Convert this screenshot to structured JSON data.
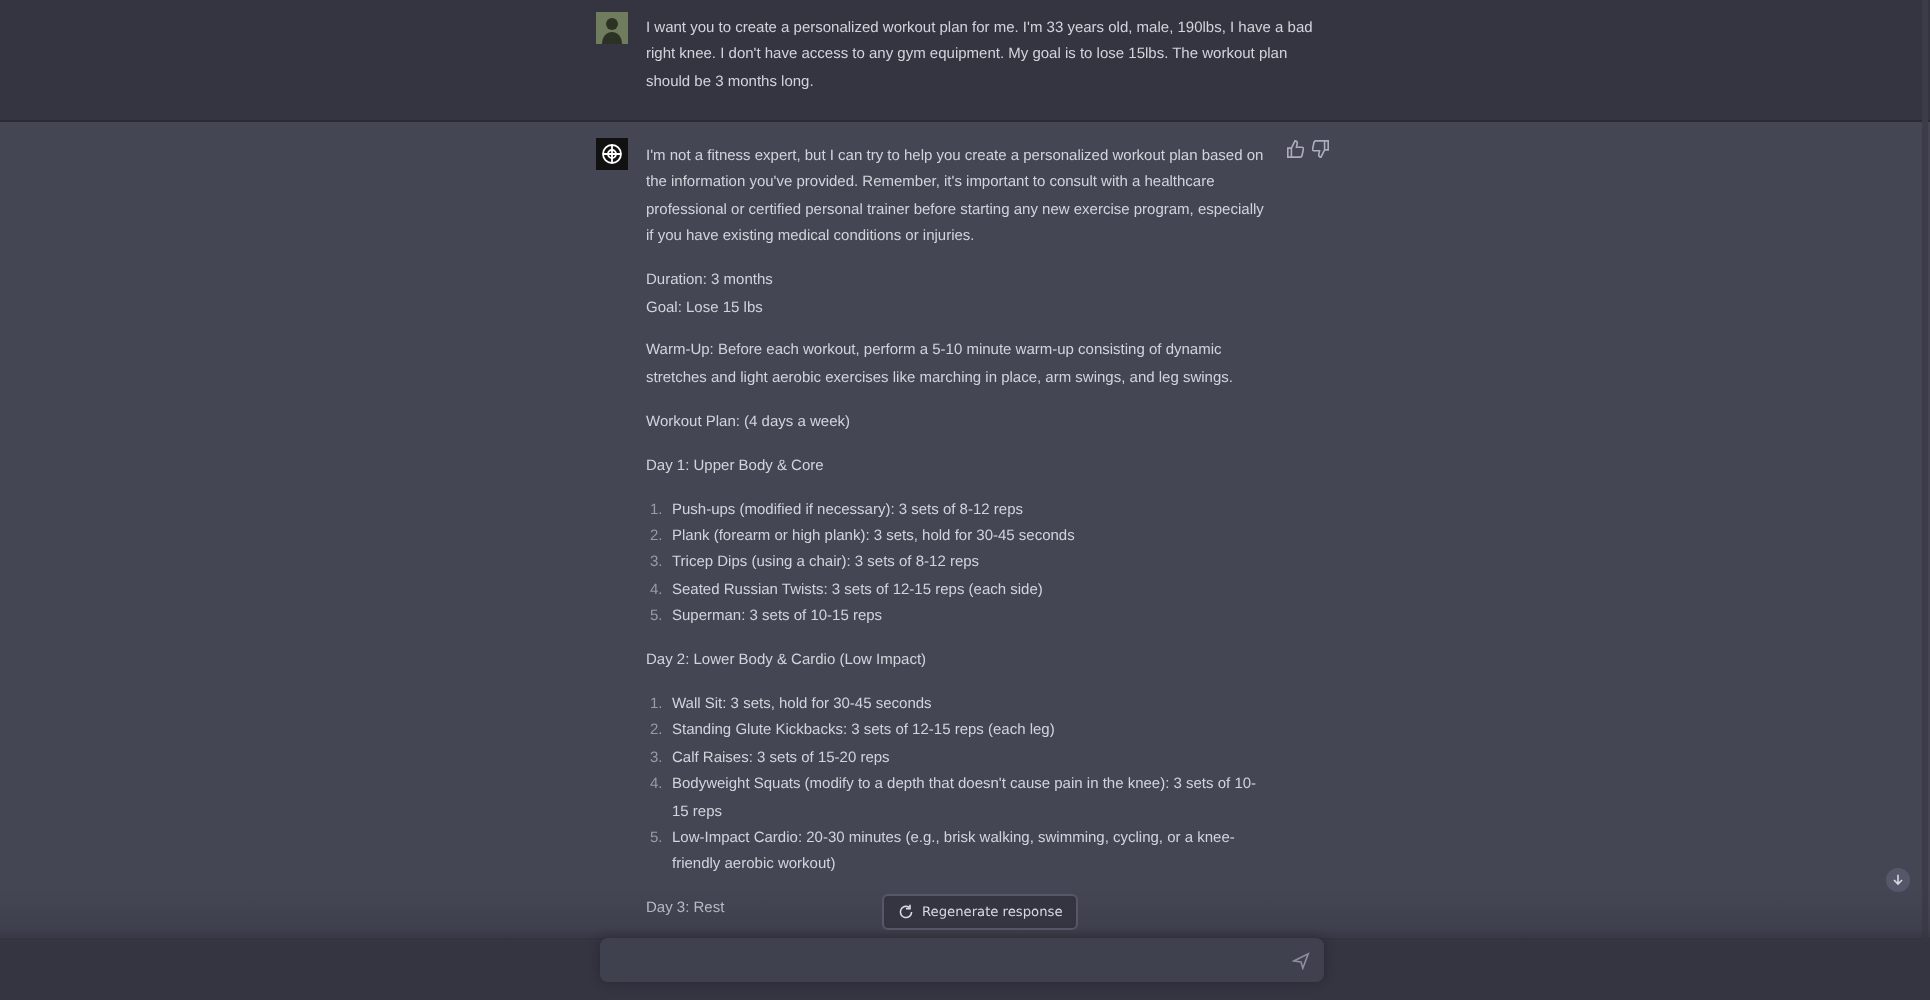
{
  "conversation": [
    {
      "kind": "user",
      "blocks": [
        {
          "kind": "paragraph",
          "text": "I want you to create a personalized workout plan for me. I'm 33 years old, male, 190lbs, I have a bad right knee. I don't have access to any gym equipment. My goal is to lose 15lbs. The workout plan should be 3 months long."
        }
      ]
    },
    {
      "kind": "assistant",
      "blocks": [
        {
          "kind": "paragraph",
          "text": "I'm not a fitness expert, but I can try to help you create a personalized workout plan based on the information you've provided. Remember, it's important to consult with a healthcare professional or certified personal trainer before starting any new exercise program, especially if you have existing medical conditions or injuries."
        },
        {
          "kind": "lines",
          "lines": [
            "Duration: 3 months",
            "Goal: Lose 15 lbs"
          ]
        },
        {
          "kind": "paragraph",
          "text": "Warm-Up: Before each workout, perform a 5-10 minute warm-up consisting of dynamic stretches and light aerobic exercises like marching in place, arm swings, and leg swings."
        },
        {
          "kind": "paragraph",
          "text": "Workout Plan: (4 days a week)"
        },
        {
          "kind": "paragraph",
          "text": "Day 1: Upper Body & Core"
        },
        {
          "kind": "list",
          "items": [
            {
              "number": "1.",
              "text": "Push-ups (modified if necessary): 3 sets of 8-12 reps"
            },
            {
              "number": "2.",
              "text": "Plank (forearm or high plank): 3 sets, hold for 30-45 seconds"
            },
            {
              "number": "3.",
              "text": "Tricep Dips (using a chair): 3 sets of 8-12 reps"
            },
            {
              "number": "4.",
              "text": "Seated Russian Twists: 3 sets of 12-15 reps (each side)"
            },
            {
              "number": "5.",
              "text": "Superman: 3 sets of 10-15 reps"
            }
          ]
        },
        {
          "kind": "paragraph",
          "text": "Day 2: Lower Body & Cardio (Low Impact)"
        },
        {
          "kind": "list",
          "items": [
            {
              "number": "1.",
              "text": "Wall Sit: 3 sets, hold for 30-45 seconds"
            },
            {
              "number": "2.",
              "text": "Standing Glute Kickbacks: 3 sets of 12-15 reps (each leg)"
            },
            {
              "number": "3.",
              "text": "Calf Raises: 3 sets of 15-20 reps"
            },
            {
              "number": "4.",
              "text": "Bodyweight Squats (modify to a depth that doesn't cause pain in the knee): 3 sets of 10-15 reps"
            },
            {
              "number": "5.",
              "text": "Low-Impact Cardio: 20-30 minutes (e.g., brisk walking, swimming, cycling, or a knee-friendly aerobic workout)"
            }
          ]
        },
        {
          "kind": "paragraph",
          "text": "Day 3: Rest"
        }
      ]
    }
  ],
  "regenerate_button": {
    "label": "Regenerate response"
  }
}
